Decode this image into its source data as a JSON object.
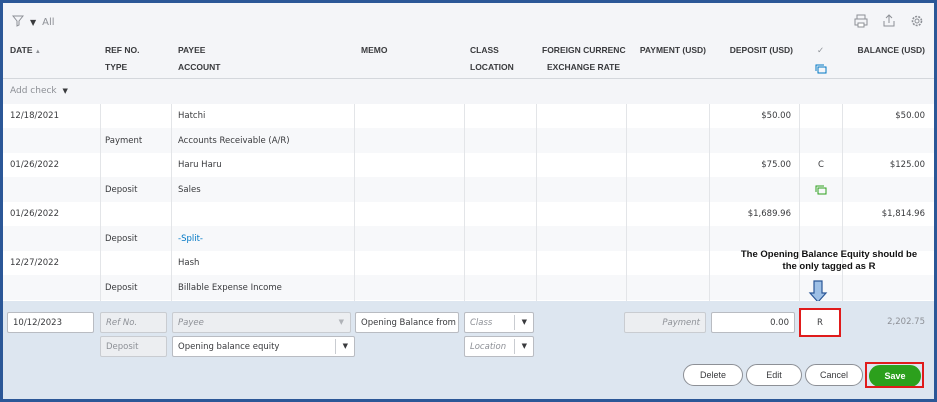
{
  "filter": {
    "label": "All"
  },
  "headers": {
    "date": "DATE",
    "date_sort": "▲",
    "ref_no": "REF NO.",
    "type": "TYPE",
    "payee": "PAYEE",
    "account": "ACCOUNT",
    "memo": "MEMO",
    "class": "CLASS",
    "location": "LOCATION",
    "foreign_currency": "FOREIGN CURRENC",
    "exchange_rate": "EXCHANGE RATE",
    "payment": "PAYMENT (USD)",
    "deposit": "DEPOSIT (USD)",
    "reconcile_mark": "✓",
    "balance": "BALANCE (USD)"
  },
  "add_check": {
    "label": "Add check"
  },
  "rows": [
    {
      "date": "12/18/2021",
      "payee": "Hatchi",
      "type": "Payment",
      "account": "Accounts Receivable (A/R)",
      "deposit": "$50.00",
      "status": "",
      "balance": "$50.00"
    },
    {
      "date": "01/26/2022",
      "payee": "Haru Haru",
      "type": "Deposit",
      "account": "Sales",
      "deposit": "$75.00",
      "status": "C",
      "balance": "$125.00"
    },
    {
      "date": "01/26/2022",
      "payee": "",
      "type": "Deposit",
      "account": "-Split-",
      "deposit": "$1,689.96",
      "status": "",
      "balance": "$1,814.96"
    },
    {
      "date": "12/27/2022",
      "payee": "Hash",
      "type": "Deposit",
      "account": "Billable Expense Income",
      "deposit": "",
      "status": "",
      "balance": ""
    }
  ],
  "annotation": {
    "text": "The Opening Balance Equity should be the only tagged as R"
  },
  "edit_row": {
    "date": "10/12/2023",
    "ref_placeholder": "Ref No.",
    "payee_placeholder": "Payee",
    "memo": "Opening Balance from",
    "class_placeholder": "Class",
    "location_placeholder": "Location",
    "type": "Deposit",
    "account": "Opening balance equity",
    "payment_placeholder": "Payment",
    "deposit": "0.00",
    "status": "R",
    "balance": "2,202.75"
  },
  "buttons": {
    "delete": "Delete",
    "edit": "Edit",
    "cancel": "Cancel",
    "save": "Save"
  },
  "colors": {
    "accent": "#2ca01c",
    "link": "#0077c5",
    "highlight": "#e01b1b",
    "frame": "#2b5797"
  }
}
